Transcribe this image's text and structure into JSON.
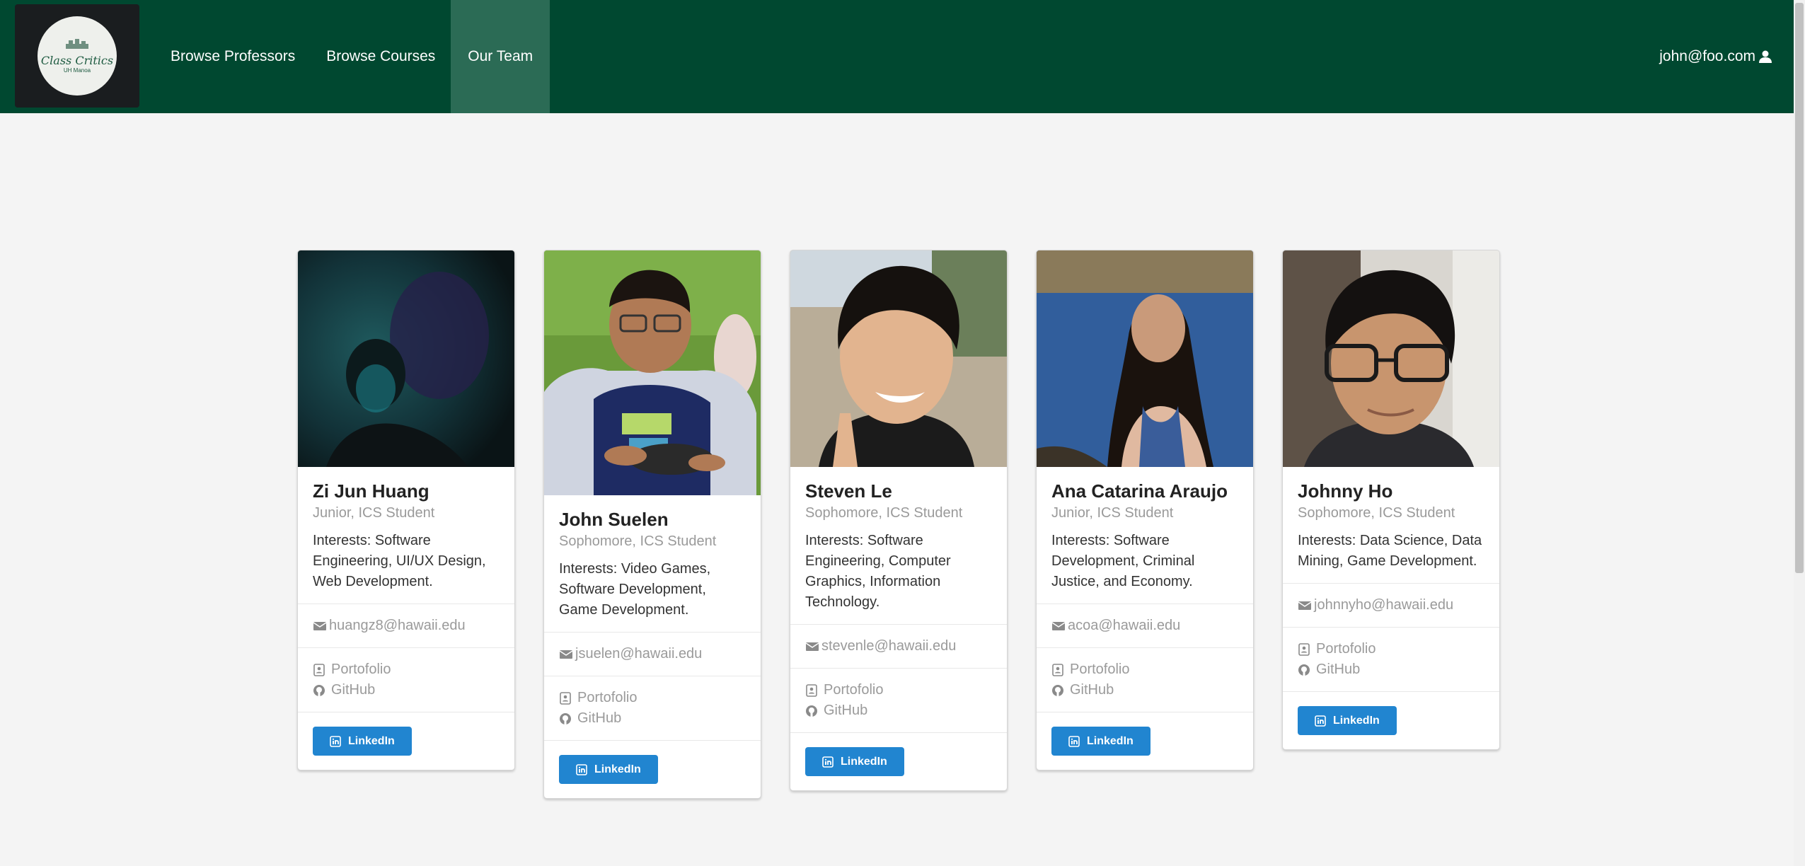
{
  "brand": {
    "logo_title": "Class Critics",
    "logo_subtitle": "UH Manoa"
  },
  "nav": {
    "items": [
      {
        "label": "Browse Professors",
        "active": false
      },
      {
        "label": "Browse Courses",
        "active": false
      },
      {
        "label": "Our Team",
        "active": true
      }
    ],
    "user_email": "john@foo.com"
  },
  "colors": {
    "navbar": "#004830",
    "nav_active": "#2b6b55",
    "button": "#2185d0",
    "page_bg": "#f4f4f4"
  },
  "team": [
    {
      "name": "Zi Jun Huang",
      "meta": "Junior, ICS Student",
      "interests": "Interests: Software Engineering, UI/UX Design, Web Development.",
      "email": "huangz8@hawaii.edu",
      "portfolio": "Portofolio",
      "github": "GitHub",
      "linkedin": "LinkedIn"
    },
    {
      "name": "John Suelen",
      "meta": "Sophomore, ICS Student",
      "interests": "Interests: Video Games, Software Development, Game Development.",
      "email": "jsuelen@hawaii.edu",
      "portfolio": "Portofolio",
      "github": "GitHub",
      "linkedin": "LinkedIn"
    },
    {
      "name": "Steven Le",
      "meta": "Sophomore, ICS Student",
      "interests": "Interests: Software Engineering, Computer Graphics, Information Technology.",
      "email": "stevenle@hawaii.edu",
      "portfolio": "Portofolio",
      "github": "GitHub",
      "linkedin": "LinkedIn"
    },
    {
      "name": "Ana Catarina Araujo",
      "meta": "Junior, ICS Student",
      "interests": "Interests: Software Development, Criminal Justice, and Economy.",
      "email": "acoa@hawaii.edu",
      "portfolio": "Portofolio",
      "github": "GitHub",
      "linkedin": "LinkedIn"
    },
    {
      "name": "Johnny Ho",
      "meta": "Sophomore, ICS Student",
      "interests": "Interests: Data Science, Data Mining, Game Development.",
      "email": "johnnyho@hawaii.edu",
      "portfolio": "Portofolio",
      "github": "GitHub",
      "linkedin": "LinkedIn"
    }
  ]
}
